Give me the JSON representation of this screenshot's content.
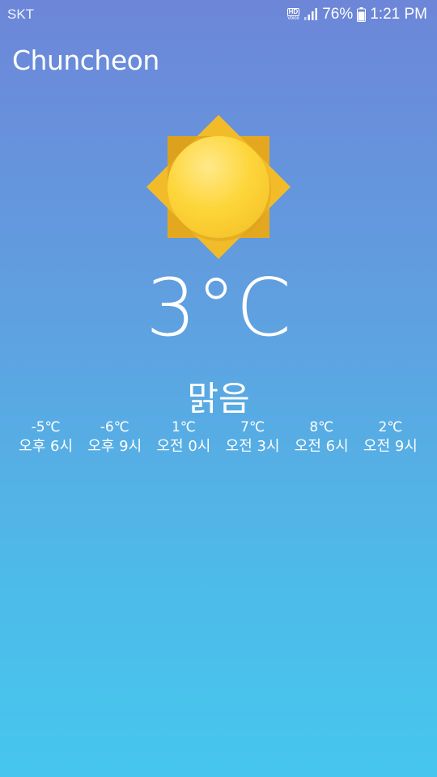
{
  "status_bar": {
    "carrier": "SKT",
    "hd_label": "HD",
    "voice_label": "Voice",
    "battery": "76%",
    "time": "1:21 PM"
  },
  "location": {
    "city": "Chuncheon"
  },
  "current": {
    "temperature": "3°C",
    "condition": "맑음",
    "icon": "sun-icon"
  },
  "forecast": [
    {
      "temp": "-5℃",
      "time": "오후 6시"
    },
    {
      "temp": "-6℃",
      "time": "오후 9시"
    },
    {
      "temp": "1℃",
      "time": "오전 0시"
    },
    {
      "temp": "7℃",
      "time": "오전 3시"
    },
    {
      "temp": "8℃",
      "time": "오전 6시"
    },
    {
      "temp": "2℃",
      "time": "오전 9시"
    }
  ],
  "colors": {
    "gradient_top": "#6d86d8",
    "gradient_bottom": "#46c6ee",
    "sun_core": "#fcd535",
    "sun_rays": "#f0b428"
  }
}
